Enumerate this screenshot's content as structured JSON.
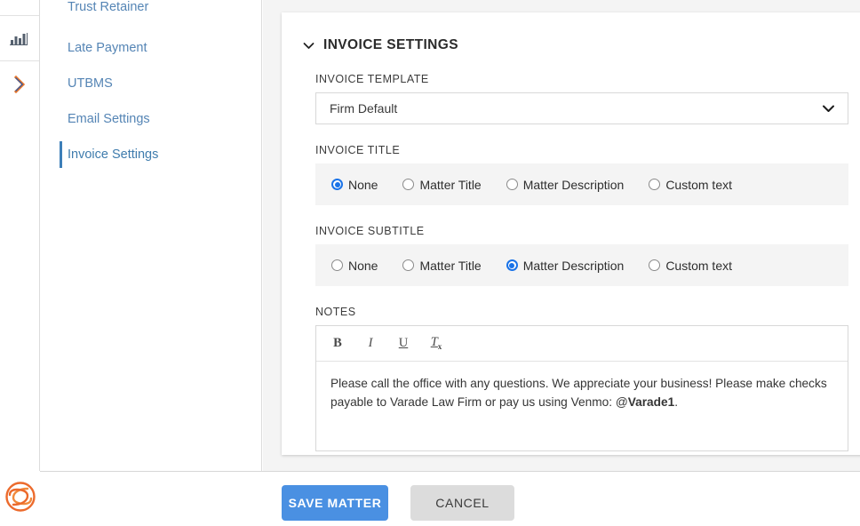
{
  "rail": {
    "chart_icon": "bar-chart-icon",
    "expand_icon": "chevron-right-icon",
    "logo": "spiral-s-logo"
  },
  "subnav": {
    "items": [
      {
        "label": "Trust Retainer",
        "active": false
      },
      {
        "label": "Late Payment",
        "active": false
      },
      {
        "label": "UTBMS",
        "active": false
      },
      {
        "label": "Email Settings",
        "active": false
      },
      {
        "label": "Invoice Settings",
        "active": true
      }
    ]
  },
  "section": {
    "title": "INVOICE SETTINGS",
    "collapse_icon": "chevron-down-icon"
  },
  "invoice_template": {
    "label": "INVOICE TEMPLATE",
    "value": "Firm Default",
    "chevron_icon": "chevron-down-icon"
  },
  "invoice_title": {
    "label": "INVOICE TITLE",
    "options": [
      {
        "label": "None",
        "checked": true
      },
      {
        "label": "Matter Title",
        "checked": false
      },
      {
        "label": "Matter Description",
        "checked": false
      },
      {
        "label": "Custom text",
        "checked": false
      }
    ]
  },
  "invoice_subtitle": {
    "label": "INVOICE SUBTITLE",
    "options": [
      {
        "label": "None",
        "checked": false
      },
      {
        "label": "Matter Title",
        "checked": false
      },
      {
        "label": "Matter Description",
        "checked": true
      },
      {
        "label": "Custom text",
        "checked": false
      }
    ]
  },
  "notes": {
    "label": "NOTES",
    "toolbar": [
      {
        "name": "bold-icon",
        "glyph": "B"
      },
      {
        "name": "italic-icon",
        "glyph": "I"
      },
      {
        "name": "underline-icon",
        "glyph": "U"
      },
      {
        "name": "remove-format-icon",
        "glyph": "T"
      }
    ],
    "text_before_bold": "Please call the office with any questions. We appreciate your business! Please make checks payable to Varade Law Firm or pay us using Venmo: @",
    "bold_text": "Varade1",
    "text_after_bold": "."
  },
  "footer": {
    "save_label": "SAVE MATTER",
    "cancel_label": "CANCEL"
  },
  "colors": {
    "accent_blue": "#4a90e2",
    "radio_blue": "#1a73e8",
    "nav_link": "#5585b5",
    "logo_orange": "#e8652a",
    "page_bg": "#f4f4f4"
  }
}
